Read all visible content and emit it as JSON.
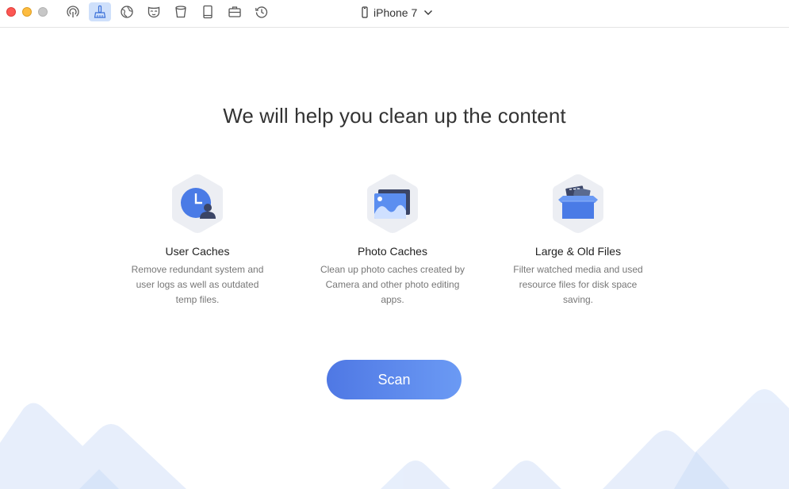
{
  "window": {
    "device_name": "iPhone 7"
  },
  "toolbar": {
    "tools": [
      {
        "name": "airbackup-icon",
        "active": false
      },
      {
        "name": "cleaner-icon",
        "active": true
      },
      {
        "name": "globe-icon",
        "active": false
      },
      {
        "name": "privacy-mask-icon",
        "active": false
      },
      {
        "name": "trash-bin-icon",
        "active": false
      },
      {
        "name": "book-icon",
        "active": false
      },
      {
        "name": "toolbox-icon",
        "active": false
      },
      {
        "name": "history-icon",
        "active": false
      }
    ]
  },
  "main": {
    "headline": "We will help you clean up the content",
    "features": [
      {
        "title": "User Caches",
        "description": "Remove redundant system and user logs as well as outdated temp files."
      },
      {
        "title": "Photo Caches",
        "description": "Clean up photo caches created by Camera and other photo editing apps."
      },
      {
        "title": "Large & Old Files",
        "description": "Filter watched media and used resource files for disk space saving."
      }
    ],
    "scan_label": "Scan"
  },
  "colors": {
    "accent": "#4f78e4",
    "accent_light": "#6b9af4",
    "hex_bg": "#eceef3",
    "mountain": "#e6eefb"
  }
}
